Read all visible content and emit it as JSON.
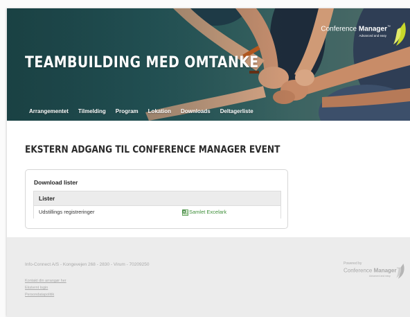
{
  "hero": {
    "title": "TEAMBUILDING MED OMTANKE",
    "nav": [
      "Arrangementet",
      "Tilmelding",
      "Program",
      "Lokation",
      "Downloads",
      "Deltagerliste"
    ]
  },
  "brand": {
    "name_light": "Conference ",
    "name_bold": "Manager",
    "tm": "™",
    "tagline": "Advanced and easy"
  },
  "main": {
    "title": "EKSTERN ADGANG TIL CONFERENCE MANAGER EVENT",
    "panel_title": "Download lister",
    "table_header": "Lister",
    "rows": [
      {
        "label": "Udstillings registreringer",
        "link": "Samlet Excelark"
      }
    ]
  },
  "footer": {
    "address": "Info-Connect A/S - Kongevejen 268 - 2830 - Virum - 70209250",
    "links": [
      "Kontakt din arrangør her",
      "Eksternt login",
      "Persondatapolitik"
    ],
    "powered_by": "Powered by",
    "brand_light": "Conference ",
    "brand_bold": "Manager",
    "brand_tm": "™",
    "brand_tagline": "Advanced and easy"
  },
  "colors": {
    "hero_bg": "#26585b",
    "brand_leaf": "#c8d82a",
    "link_green": "#3f8f3a",
    "footer_bg": "#ececec"
  },
  "icons": {
    "excel": "excel-file-icon",
    "brand": "brand-leaf-icon"
  }
}
